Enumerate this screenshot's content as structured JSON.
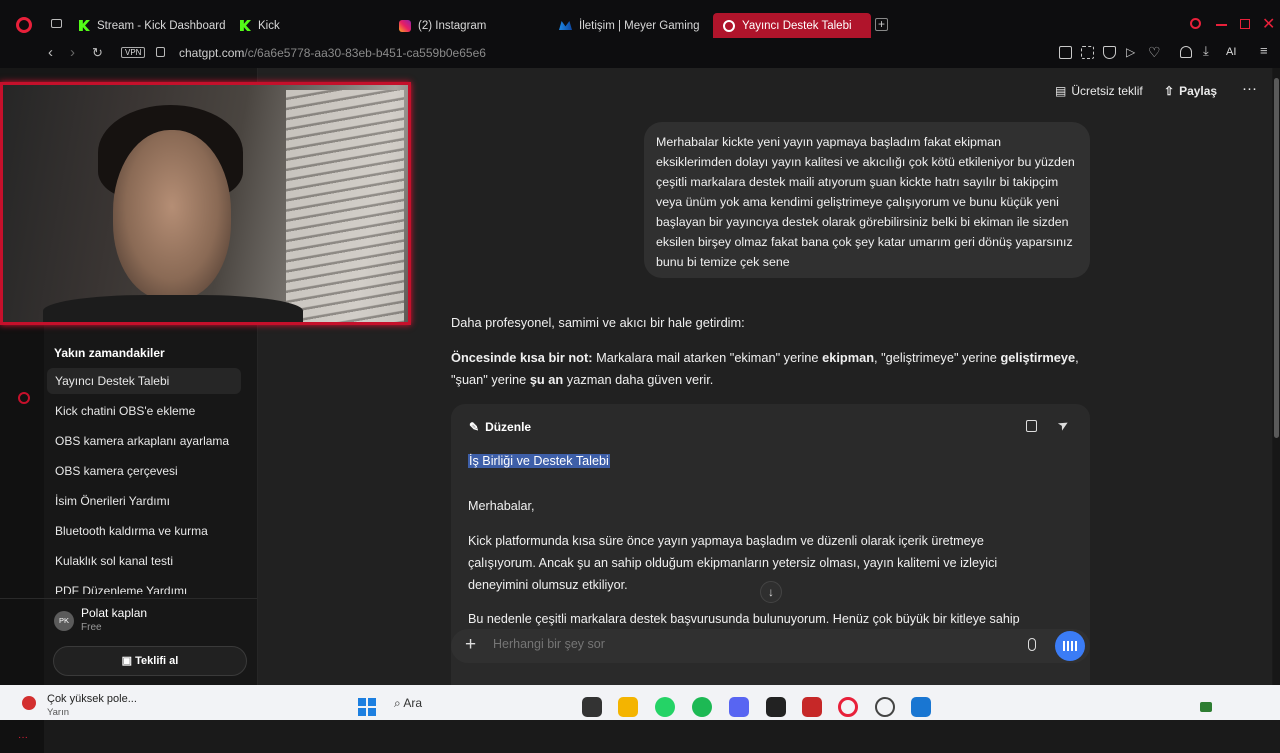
{
  "browser": {
    "tabs": [
      {
        "label": "Stream - Kick Dashboard",
        "icon": "kick-icon"
      },
      {
        "label": "Kick",
        "icon": "kick-icon"
      },
      {
        "label": "(2) Instagram",
        "icon": "instagram-icon"
      },
      {
        "label": "İletişim | Meyer Gaming",
        "icon": "meyer-icon"
      },
      {
        "label": "Yayıncı Destek Talebi",
        "icon": "chatgpt-icon",
        "active": true
      }
    ],
    "url_host": "chatgpt.com",
    "url_path": "/c/6a6e5778-aa30-83eb-b451-ca559b0e65e6",
    "vpn_label": "VPN",
    "ai_label": "AI"
  },
  "header": {
    "offer_label": "Ücretsiz teklif",
    "share_label": "Paylaş"
  },
  "sidebar": {
    "section_title": "Yakın zamandakiler",
    "items": [
      {
        "label": "Yayıncı Destek Talebi",
        "active": true
      },
      {
        "label": "Kick chatini OBS'e ekleme"
      },
      {
        "label": "OBS kamera arkaplanı ayarlama"
      },
      {
        "label": "OBS kamera çerçevesi"
      },
      {
        "label": "İsim Önerileri Yardımı"
      },
      {
        "label": "Bluetooth kaldırma ve kurma"
      },
      {
        "label": "Kulaklık sol kanal testi"
      },
      {
        "label": "PDF Düzenleme Yardımı"
      }
    ],
    "user": {
      "initials": "PK",
      "name": "Polat kaplan",
      "plan": "Free"
    },
    "offer_button": "Teklifi al",
    "gx_label": "GX"
  },
  "chat": {
    "user_message": "Merhabalar kickte yeni yayın yapmaya başladım fakat ekipman eksiklerimden dolayı yayın kalitesi ve akıcılığı çok kötü etkileniyor bu yüzden çeşitli markalara destek maili atıyorum şuan kickte hatrı sayılır bi takipçim veya ünüm yok ama kendimi geliştrimeye çalışıyorum ve bunu küçük yeni başlayan bir yayıncıya destek olarak görebilirsiniz belki bi ekiman ile sizden eksilen birşey olmaz fakat bana çok şey katar umarım geri dönüş yaparsınız bunu bi temize çek sene",
    "response_intro": "Daha profesyonel, samimi ve akıcı bir hale getirdim:",
    "note_label": "Öncesinde kısa bir not:",
    "note_text_1": " Markalara mail atarken \"ekiman\" yerine ",
    "note_bold_1": "ekipman",
    "note_text_2": ", \"geliştrimeye\" yerine ",
    "note_bold_2": "geliştirmeye",
    "note_text_3": ", \"şuan\" yerine ",
    "note_bold_3": "şu an",
    "note_text_4": " yazman daha güven verir."
  },
  "canvas": {
    "edit_label": "Düzenle",
    "subject": "İş Birliği ve Destek Talebi",
    "greeting": "Merhabalar,",
    "paragraph1": "Kick platformunda kısa süre önce yayın yapmaya başladım ve düzenli olarak içerik üretmeye çalışıyorum. Ancak şu an sahip olduğum ekipmanların yetersiz olması, yayın kalitemi ve izleyici deneyimini olumsuz etkiliyor.",
    "paragraph2": "Bu nedenle çeşitli markalara destek başvurusunda bulunuyorum. Henüz çok büyük bir kitleye sahip"
  },
  "composer": {
    "placeholder": "Herhangi bir şey sor"
  },
  "taskbar": {
    "notification_title": "Çok yüksek pole...",
    "notification_sub": "Yarın",
    "search_label": "Ara"
  }
}
